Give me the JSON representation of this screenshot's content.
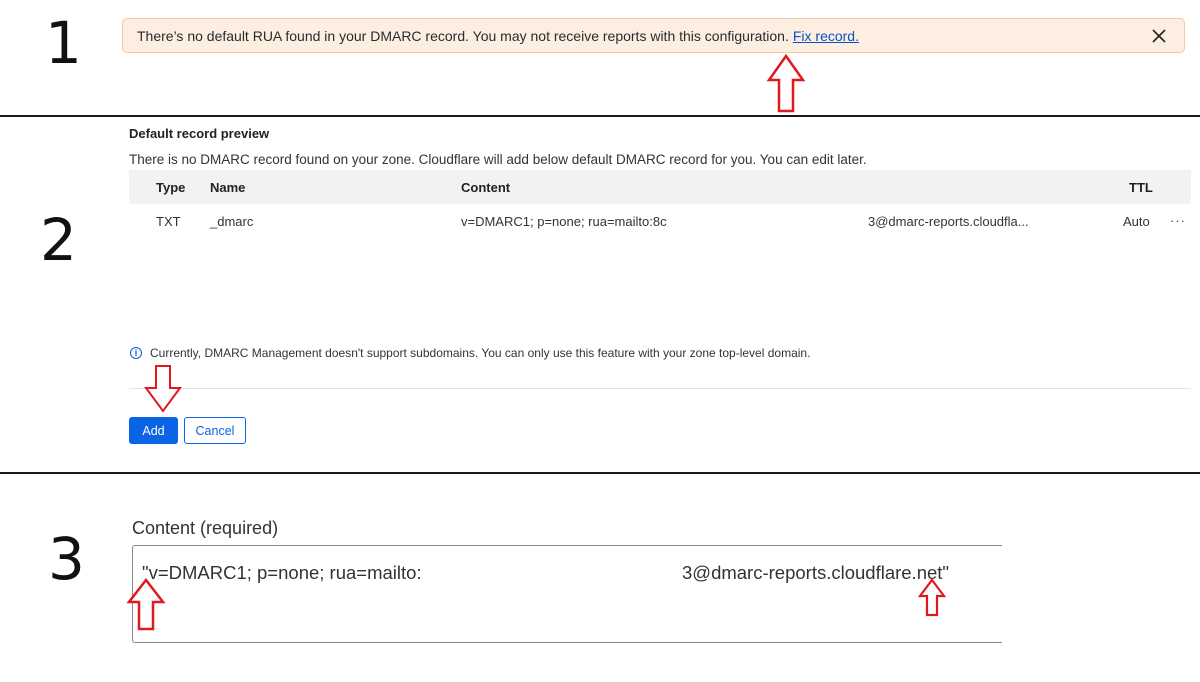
{
  "steps": {
    "one": "1",
    "two": "2",
    "three": "3"
  },
  "banner": {
    "message": "There’s no default RUA found in your DMARC record. You may not receive reports with this configuration.",
    "link_text": "Fix record.",
    "close_icon": "close-icon"
  },
  "preview": {
    "title": "Default record preview",
    "description": "There is no DMARC record found on your zone. Cloudflare will add below default DMARC record for you. You can edit later.",
    "columns": [
      "Type",
      "Name",
      "Content",
      "TTL"
    ],
    "row": {
      "type": "TXT",
      "name": "_dmarc",
      "content_start": "v=DMARC1; p=none; rua=mailto:8c",
      "content_end": "3@dmarc-reports.cloudfla...",
      "ttl": "Auto",
      "menu": "···"
    },
    "info_icon": "info-icon",
    "info": "Currently, DMARC Management doesn't support subdomains. You can only use this feature with your zone top-level domain.",
    "add_label": "Add",
    "cancel_label": "Cancel"
  },
  "content_field": {
    "label": "Content (required)",
    "value_start": "\"v=DMARC1;  p=none; rua=mailto:8",
    "value_end": "3@dmarc-reports.cloudflare.net\""
  },
  "colors": {
    "banner_bg": "#fcefe2",
    "banner_border": "#f3c9a4",
    "link": "#0b4fc4",
    "primary": "#0b63e5",
    "annotation_arrow": "#e0191e"
  }
}
